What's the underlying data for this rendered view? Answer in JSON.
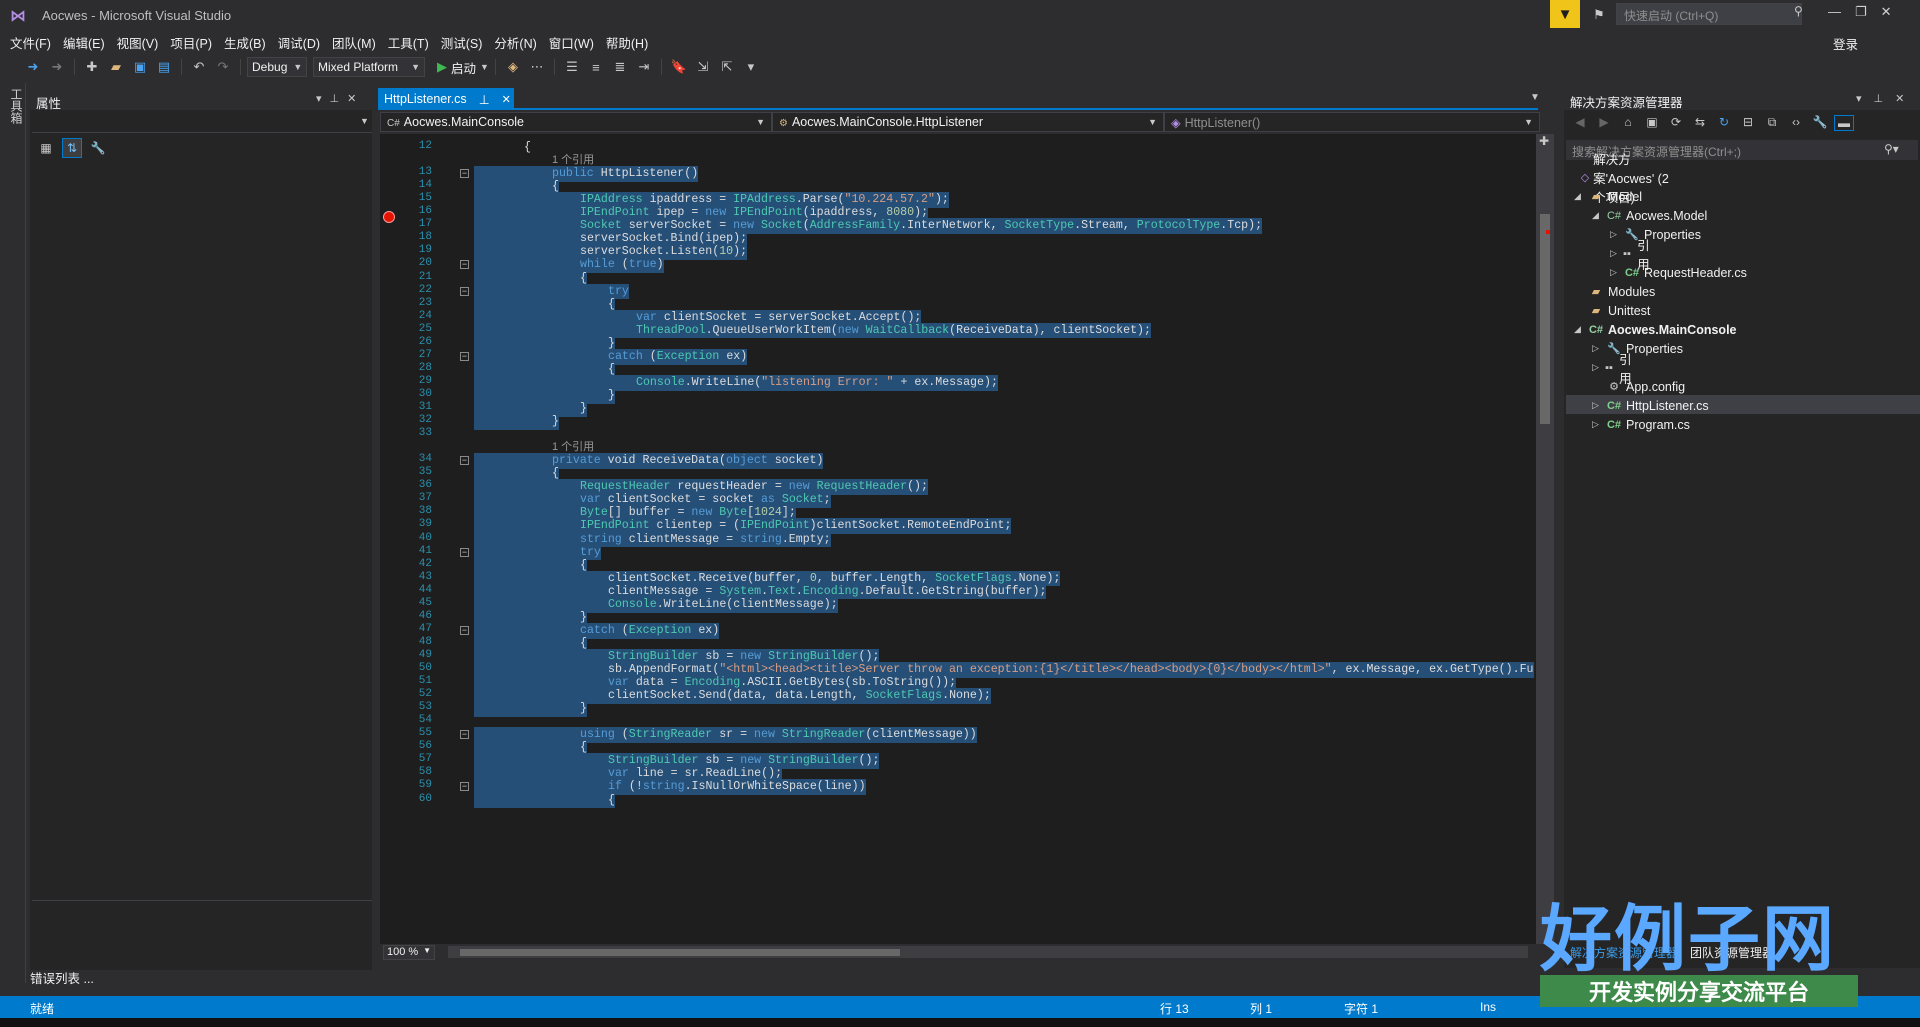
{
  "window": {
    "title": "Aocwes - Microsoft Visual Studio",
    "quick_launch_placeholder": "快速启动 (Ctrl+Q)",
    "login": "登录"
  },
  "menu": [
    "文件(F)",
    "编辑(E)",
    "视图(V)",
    "项目(P)",
    "生成(B)",
    "调试(D)",
    "团队(M)",
    "工具(T)",
    "测试(S)",
    "分析(N)",
    "窗口(W)",
    "帮助(H)"
  ],
  "toolbar": {
    "config": "Debug",
    "platform": "Mixed Platform",
    "start_label": "启动"
  },
  "toolbox_label": "工具箱",
  "properties": {
    "title": "属性",
    "error_list_tab": "错误列表 ..."
  },
  "editor": {
    "tab_label": "HttpListener.cs",
    "nav_project": "Aocwes.MainConsole",
    "nav_class": "Aocwes.MainConsole.HttpListener",
    "nav_member": "HttpListener()",
    "zoom": "100 %",
    "ref_label": "1 个引用",
    "lines": [
      {
        "n": "12",
        "code": "{",
        "indent": 1,
        "sel": false
      },
      {
        "ref": true,
        "indent": 2
      },
      {
        "n": "13",
        "code": "public HttpListener()",
        "indent": 2,
        "sel": true,
        "fold": true
      },
      {
        "n": "14",
        "code": "{",
        "indent": 2,
        "sel": true
      },
      {
        "n": "15",
        "code": "IPAddress ipaddress = IPAddress.Parse(\"10.224.57.2\");",
        "indent": 3,
        "sel": true
      },
      {
        "n": "16",
        "code": "IPEndPoint ipep = new IPEndPoint(ipaddress, 8080);",
        "indent": 3,
        "sel": true
      },
      {
        "n": "17",
        "code": "Socket serverSocket = new Socket(AddressFamily.InterNetwork, SocketType.Stream, ProtocolType.Tcp);",
        "indent": 3,
        "sel": true
      },
      {
        "n": "18",
        "code": "serverSocket.Bind(ipep);",
        "indent": 3,
        "sel": true
      },
      {
        "n": "19",
        "code": "serverSocket.Listen(10);",
        "indent": 3,
        "sel": true
      },
      {
        "n": "20",
        "code": "while (true)",
        "indent": 3,
        "sel": true,
        "fold": true
      },
      {
        "n": "21",
        "code": "{",
        "indent": 3,
        "sel": true
      },
      {
        "n": "22",
        "code": "try",
        "indent": 4,
        "sel": true,
        "fold": true
      },
      {
        "n": "23",
        "code": "{",
        "indent": 4,
        "sel": true
      },
      {
        "n": "24",
        "code": "var clientSocket = serverSocket.Accept();",
        "indent": 5,
        "sel": true
      },
      {
        "n": "25",
        "code": "ThreadPool.QueueUserWorkItem(new WaitCallback(ReceiveData), clientSocket);",
        "indent": 5,
        "sel": true
      },
      {
        "n": "26",
        "code": "}",
        "indent": 4,
        "sel": true
      },
      {
        "n": "27",
        "code": "catch (Exception ex)",
        "indent": 4,
        "sel": true,
        "fold": true
      },
      {
        "n": "28",
        "code": "{",
        "indent": 4,
        "sel": true
      },
      {
        "n": "29",
        "code": "Console.WriteLine(\"listening Error: \" + ex.Message);",
        "indent": 5,
        "sel": true
      },
      {
        "n": "30",
        "code": "}",
        "indent": 4,
        "sel": true
      },
      {
        "n": "31",
        "code": "}",
        "indent": 3,
        "sel": true
      },
      {
        "n": "32",
        "code": "}",
        "indent": 2,
        "sel": true
      },
      {
        "n": "33",
        "code": "",
        "indent": 0,
        "sel": false
      },
      {
        "ref": true,
        "indent": 2
      },
      {
        "n": "34",
        "code": "private void ReceiveData(object socket)",
        "indent": 2,
        "sel": true,
        "fold": true
      },
      {
        "n": "35",
        "code": "{",
        "indent": 2,
        "sel": true
      },
      {
        "n": "36",
        "code": "RequestHeader requestHeader = new RequestHeader();",
        "indent": 3,
        "sel": true
      },
      {
        "n": "37",
        "code": "var clientSocket = socket as Socket;",
        "indent": 3,
        "sel": true
      },
      {
        "n": "38",
        "code": "Byte[] buffer = new Byte[1024];",
        "indent": 3,
        "sel": true
      },
      {
        "n": "39",
        "code": "IPEndPoint clientep = (IPEndPoint)clientSocket.RemoteEndPoint;",
        "indent": 3,
        "sel": true
      },
      {
        "n": "40",
        "code": "string clientMessage = string.Empty;",
        "indent": 3,
        "sel": true
      },
      {
        "n": "41",
        "code": "try",
        "indent": 3,
        "sel": true,
        "fold": true
      },
      {
        "n": "42",
        "code": "{",
        "indent": 3,
        "sel": true
      },
      {
        "n": "43",
        "code": "clientSocket.Receive(buffer, 0, buffer.Length, SocketFlags.None);",
        "indent": 4,
        "sel": true
      },
      {
        "n": "44",
        "code": "clientMessage = System.Text.Encoding.Default.GetString(buffer);",
        "indent": 4,
        "sel": true
      },
      {
        "n": "45",
        "code": "Console.WriteLine(clientMessage);",
        "indent": 4,
        "sel": true
      },
      {
        "n": "46",
        "code": "}",
        "indent": 3,
        "sel": true
      },
      {
        "n": "47",
        "code": "catch (Exception ex)",
        "indent": 3,
        "sel": true,
        "fold": true
      },
      {
        "n": "48",
        "code": "{",
        "indent": 3,
        "sel": true
      },
      {
        "n": "49",
        "code": "StringBuilder sb = new StringBuilder();",
        "indent": 4,
        "sel": true
      },
      {
        "n": "50",
        "code": "sb.AppendFormat(\"<html><head><title>Server throw an exception:{1}</title></head><body>{0}</body></html>\", ex.Message, ex.GetType().FullN",
        "indent": 4,
        "sel": true
      },
      {
        "n": "51",
        "code": "var data = Encoding.ASCII.GetBytes(sb.ToString());",
        "indent": 4,
        "sel": true
      },
      {
        "n": "52",
        "code": "clientSocket.Send(data, data.Length, SocketFlags.None);",
        "indent": 4,
        "sel": true
      },
      {
        "n": "53",
        "code": "}",
        "indent": 3,
        "sel": true
      },
      {
        "n": "54",
        "code": "",
        "indent": 0,
        "sel": false
      },
      {
        "n": "55",
        "code": "using (StringReader sr = new StringReader(clientMessage))",
        "indent": 3,
        "sel": true,
        "fold": true
      },
      {
        "n": "56",
        "code": "{",
        "indent": 3,
        "sel": true
      },
      {
        "n": "57",
        "code": "StringBuilder sb = new StringBuilder();",
        "indent": 4,
        "sel": true
      },
      {
        "n": "58",
        "code": "var line = sr.ReadLine();",
        "indent": 4,
        "sel": true
      },
      {
        "n": "59",
        "code": "if (!string.IsNullOrWhiteSpace(line))",
        "indent": 4,
        "sel": true,
        "fold": true
      },
      {
        "n": "60",
        "code": "{",
        "indent": 4,
        "sel": true
      }
    ]
  },
  "solution_explorer": {
    "title": "解决方案资源管理器",
    "search_placeholder": "搜索解决方案资源管理器(Ctrl+;)",
    "items": [
      {
        "label": "解决方案'Aocwes' (2 个项目)",
        "icon": "sol",
        "depth": 0,
        "arrow": ""
      },
      {
        "label": "Model",
        "icon": "folder",
        "depth": 0,
        "arrow": "◢"
      },
      {
        "label": "Aocwes.Model",
        "icon": "proj",
        "depth": 1,
        "arrow": "◢"
      },
      {
        "label": "Properties",
        "icon": "wrench",
        "depth": 2,
        "arrow": "▷"
      },
      {
        "label": "引用",
        "icon": "ref",
        "depth": 2,
        "arrow": "▷"
      },
      {
        "label": "RequestHeader.cs",
        "icon": "cs",
        "depth": 2,
        "arrow": "▷"
      },
      {
        "label": "Modules",
        "icon": "folder",
        "depth": 0,
        "arrow": ""
      },
      {
        "label": "Unittest",
        "icon": "folder",
        "depth": 0,
        "arrow": ""
      },
      {
        "label": "Aocwes.MainConsole",
        "icon": "proj",
        "depth": 0,
        "arrow": "◢",
        "bold": true
      },
      {
        "label": "Properties",
        "icon": "wrench",
        "depth": 1,
        "arrow": "▷"
      },
      {
        "label": "引用",
        "icon": "ref",
        "depth": 1,
        "arrow": "▷"
      },
      {
        "label": "App.config",
        "icon": "cfg",
        "depth": 1,
        "arrow": ""
      },
      {
        "label": "HttpListener.cs",
        "icon": "cs",
        "depth": 1,
        "arrow": "▷",
        "selected": true
      },
      {
        "label": "Program.cs",
        "icon": "cs",
        "depth": 1,
        "arrow": "▷"
      }
    ],
    "bottom_tabs": [
      "解决方案资源管理器",
      "团队资源管理器"
    ]
  },
  "statusbar": {
    "ready": "就绪",
    "line": "行 13",
    "col": "列 1",
    "char": "字符 1",
    "ins": "Ins"
  },
  "watermark": {
    "big": "好例子网",
    "sub": "开发实例分享交流平台"
  }
}
